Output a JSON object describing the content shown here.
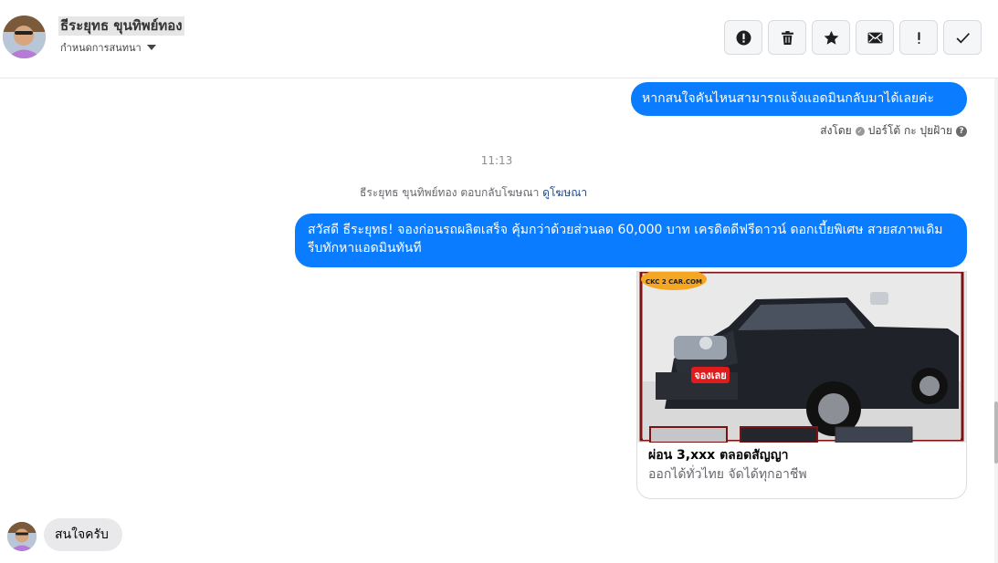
{
  "header": {
    "contact_name": "ธีระยุทธ ขุนทิพย์ทอง",
    "assign_label": "กำหนดการสนทนา",
    "toolbar": [
      {
        "name": "spam-button",
        "icon": "alert-circle-icon"
      },
      {
        "name": "delete-button",
        "icon": "trash-icon"
      },
      {
        "name": "star-button",
        "icon": "star-icon"
      },
      {
        "name": "mark-unread-button",
        "icon": "envelope-icon"
      },
      {
        "name": "follow-up-button",
        "icon": "exclamation-icon"
      },
      {
        "name": "done-button",
        "icon": "check-icon"
      }
    ]
  },
  "messages": {
    "first_outgoing": "หากสนใจคันไหนสามารถแจ้งแอดมินกลับมาได้เลยค่ะ",
    "sent_by_prefix": "ส่งโดย",
    "sent_by_name": "ปอร์โต้ กะ ปุยฝ้าย",
    "timestamp": "11:13",
    "reply_note": "ธีระยุทธ ขุนทิพย์ทอง ตอบกลับโฆษณา",
    "reply_link": "ดูโฆษณา",
    "ad_message": "สวัสดี ธีระยุทธ! จองก่อนรถผลิตเสร็จ คุ้มกว่าด้วยส่วนลด 60,000 บาท เครดิตดีฟรีดาวน์ ดอกเบี้ยพิเศษ สวยสภาพเดิม รีบทักหาแอดมินทันที",
    "ad_card": {
      "image_badge": "CKC 2 CAR.COM",
      "image_button": "จองเลย",
      "title": "ผ่อน 3,xxx ตลอดสัญญา",
      "subtitle": "ออกได้ทั่วไทย จัดได้ทุกอาชีพ"
    },
    "customer_reply": "สนใจครับ"
  },
  "colors": {
    "outgoing_bubble": "#0a7cff",
    "incoming_bubble": "#e9e9eb",
    "link": "#1c4a8f"
  }
}
